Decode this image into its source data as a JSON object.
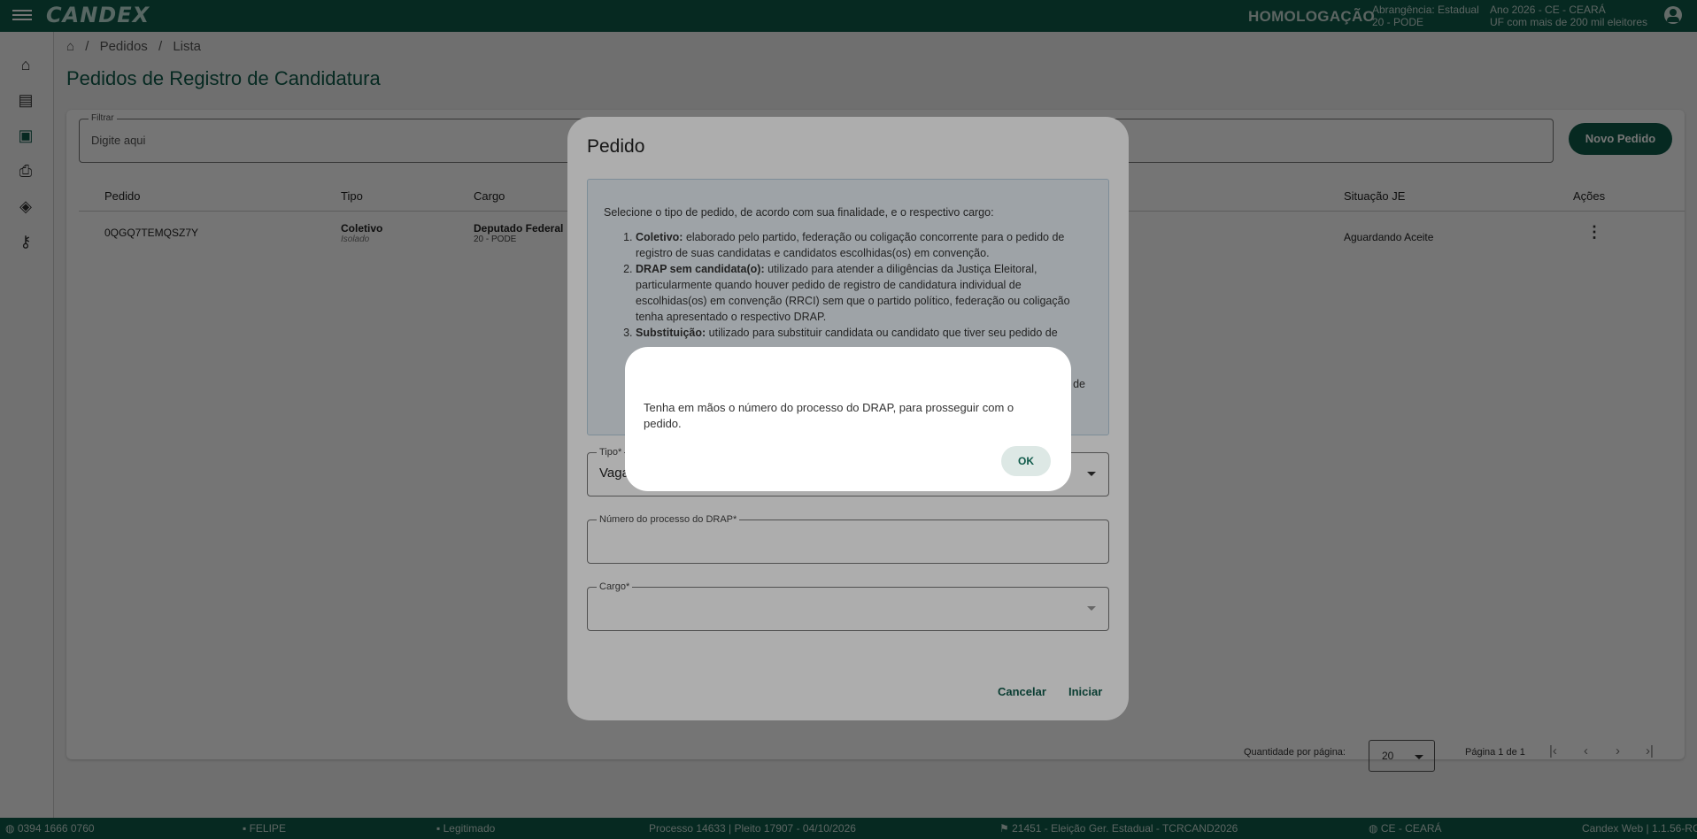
{
  "topbar": {
    "logo": "CANDEX",
    "environment": "HOMOLOGAÇÃO",
    "scope_line1": "Abrangência: Estadual",
    "scope_line2": "20 - PODE",
    "year_line1": "Ano 2026 - CE - CEARÁ",
    "year_line2": "UF com mais de 200 mil eleitores"
  },
  "breadcrumb": {
    "home_icon": "home-icon",
    "items": [
      "Pedidos",
      "Lista"
    ],
    "separator": "/"
  },
  "page": {
    "title": "Pedidos de Registro de Candidatura"
  },
  "filter": {
    "label": "Filtrar",
    "placeholder": "Digite aqui"
  },
  "new_button": "Novo Pedido",
  "table": {
    "headers": [
      "Pedido",
      "Tipo",
      "Cargo",
      "Situação JE",
      "Ações"
    ],
    "rows": [
      {
        "pedido": "0QGQ7TEMQSZ7Y",
        "tipo": "Coletivo",
        "tipo_sub": "Isolado",
        "cargo": "Deputado Federal",
        "cargo_sub": "20 - PODE",
        "situacao": "Aguardando Aceite"
      }
    ]
  },
  "pagination": {
    "per_page_label": "Quantidade por página:",
    "per_page": "20",
    "page_label": "Página 1 de 1"
  },
  "statusbar": {
    "phone": "0394 1666 0760",
    "user": "FELIPE",
    "role": "Legitimado",
    "process": "Processo 14633 | Pleito 17907 - 04/10/2026",
    "election": "21451 - Eleição Ger. Estadual - TCRCAND2026",
    "state": "CE - CEARÁ",
    "version": "Candex Web | 1.1.56-RC"
  },
  "dialog": {
    "title": "Pedido",
    "intro": "Selecione o tipo de pedido, de acordo com sua finalidade, e o respectivo cargo:",
    "items": [
      {
        "term": "Coletivo:",
        "text": " elaborado pelo partido, federação ou coligação concorrente para o pedido de registro de suas candidatas e candidatos escolhidas(os) em convenção."
      },
      {
        "term": "DRAP sem candidata(o):",
        "text": " utilizado para atender a diligências da Justiça Eleitoral, particularmente quando houver pedido de registro de candidatura individual de escolhidas(os) em convenção (RRCI) sem que o partido político, federação ou coligação tenha apresentado o respectivo DRAP."
      },
      {
        "term": "Substituição:",
        "text": " utilizado para substituir candidata ou candidato que tiver seu pedido de"
      }
    ],
    "trailing_fragment": "de",
    "tipo_label": "Tipo*",
    "tipo_value": "Vaga",
    "drap_label": "Número do processo do DRAP*",
    "cargo_label": "Cargo*",
    "cancel": "Cancelar",
    "start": "Iniciar"
  },
  "alert": {
    "message": "Tenha em mãos o número do processo do DRAP, para prosseguir com o pedido.",
    "ok": "OK"
  },
  "colors": {
    "brand": "#0f5a4a",
    "info_bg": "#e9f1f7"
  }
}
